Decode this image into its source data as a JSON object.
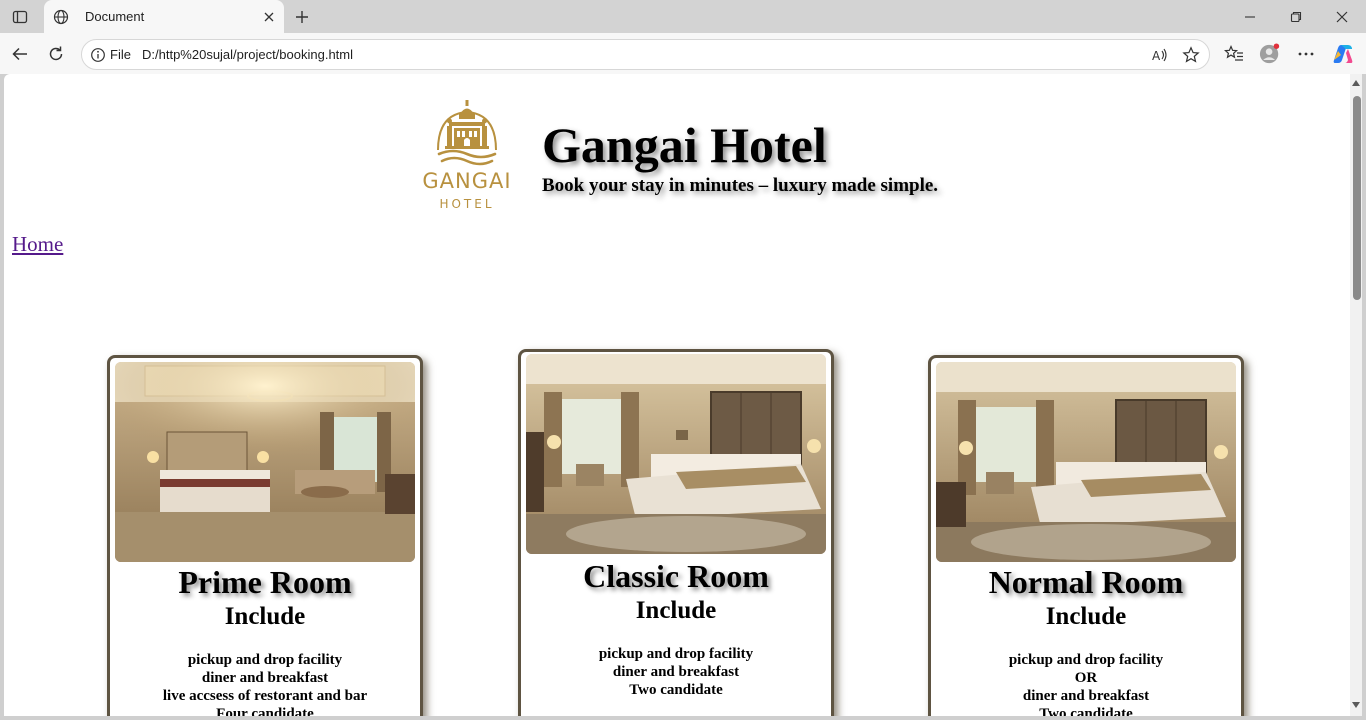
{
  "browser": {
    "tab_title": "Document",
    "omnibox_label": "File",
    "url": "D:/http%20sujal/project/booking.html",
    "icons": [
      "tab-actions-icon",
      "globe-icon",
      "close-icon",
      "plus-icon",
      "minimize-icon",
      "restore-icon",
      "window-close-icon",
      "back-arrow-icon",
      "reload-icon",
      "info-icon",
      "read-aloud-icon",
      "star-icon",
      "favorites-icon",
      "profile-icon",
      "more-icon",
      "copilot-icon"
    ]
  },
  "header": {
    "title": "Gangai Hotel",
    "tagline": "Book your stay in minutes – luxury made simple.",
    "logo_text": "GANGAI",
    "logo_subtext": "HOTEL"
  },
  "nav": {
    "home_label": "Home"
  },
  "rooms": [
    {
      "name": "Prime Room",
      "include_label": "Include",
      "features": [
        "pickup and drop facility",
        "diner and breakfast",
        "live accsess of restorant and bar",
        "Four candidate"
      ]
    },
    {
      "name": "Classic Room",
      "include_label": "Include",
      "features": [
        "pickup and drop facility",
        "diner and breakfast",
        "Two candidate"
      ]
    },
    {
      "name": "Normal Room",
      "include_label": "Include",
      "features": [
        "pickup and drop facility",
        "OR",
        "diner and breakfast",
        "Two candidate"
      ]
    }
  ],
  "colors": {
    "logo_gold": "#b8913f",
    "card_border": "#5e5442",
    "link_visited": "#551a8b"
  }
}
